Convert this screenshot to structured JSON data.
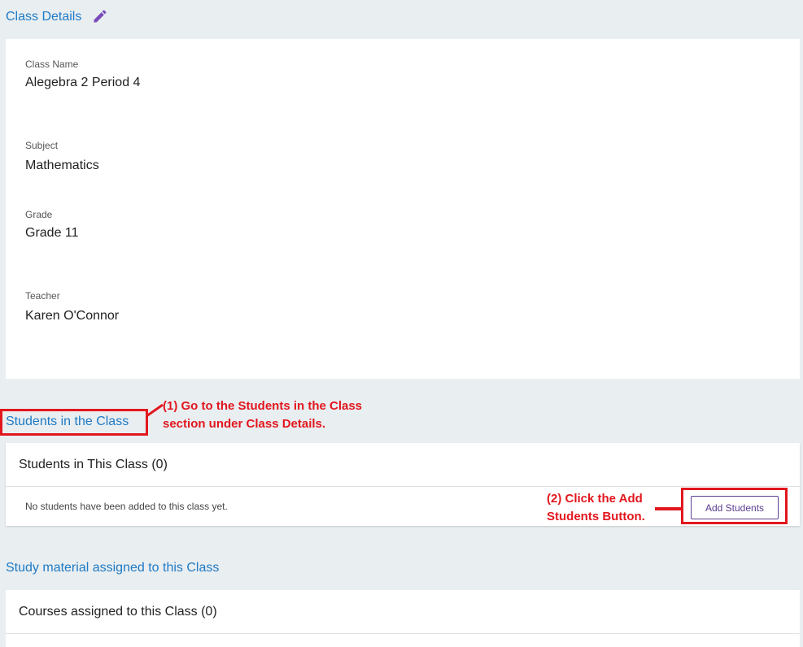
{
  "class_details": {
    "title": "Class Details",
    "edit_icon": "pencil-icon",
    "fields": [
      {
        "label": "Class Name",
        "value": "Alegebra 2 Period 4"
      },
      {
        "label": "Subject",
        "value": "Mathematics"
      },
      {
        "label": "Grade",
        "value": "Grade 11"
      },
      {
        "label": "Teacher",
        "value": "Karen O'Connor"
      }
    ]
  },
  "students_section": {
    "title": "Students in the Class",
    "card_header": "Students in This Class (0)",
    "empty_text": "No students have been added to this class yet.",
    "add_button_label": "Add Students"
  },
  "study_section": {
    "title": "Study material assigned to this Class",
    "card_header": "Courses assigned to this Class (0)"
  },
  "annotations": {
    "step1": "(1) Go to the Students in the Class section under Class Details.",
    "step2": "(2) Click the Add Students Button."
  },
  "colors": {
    "link": "#1f7ac4",
    "accent": "#5b3d8f",
    "annotation": "#e2171e",
    "background": "#e9eef1"
  }
}
